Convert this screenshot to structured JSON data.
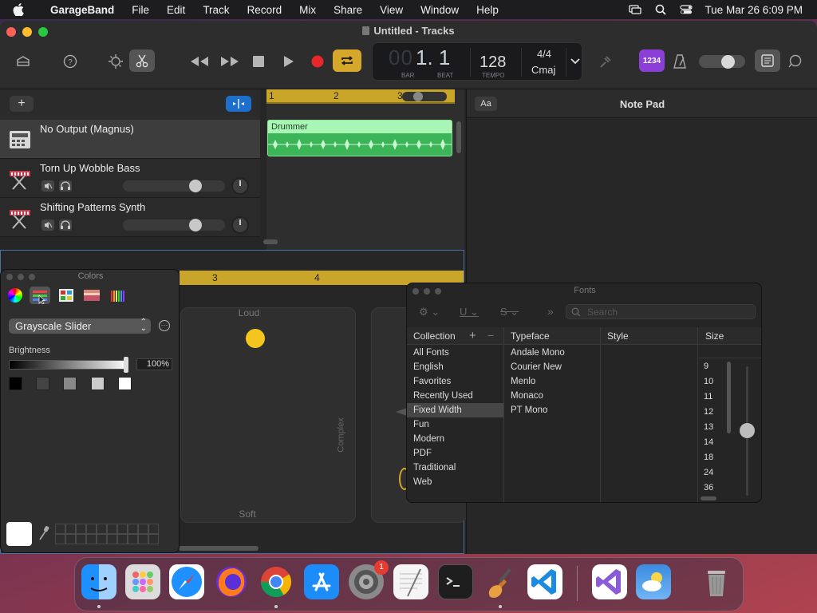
{
  "menubar": {
    "app_name": "GarageBand",
    "menus": [
      "File",
      "Edit",
      "Track",
      "Record",
      "Mix",
      "Share",
      "View",
      "Window",
      "Help"
    ],
    "clock": "Tue Mar 26  6:09 PM"
  },
  "window": {
    "title": "Untitled - Tracks"
  },
  "lcd": {
    "bar": "00",
    "beat": "1. 1",
    "bar_label": "BAR",
    "beat_label": "BEAT",
    "tempo": "128",
    "tempo_label": "TEMPO",
    "time_signature": "4/4",
    "key": "Cmaj"
  },
  "count_in_label": "1234",
  "tracks": [
    {
      "name": "No Output (Magnus)",
      "selected": true
    },
    {
      "name": "Torn Up Wobble Bass",
      "selected": false
    },
    {
      "name": "Shifting Patterns Synth",
      "selected": false
    }
  ],
  "timeline": {
    "ruler_marks": [
      "1",
      "2",
      "3"
    ],
    "region_label": "Drummer"
  },
  "smart_controls": {
    "ruler_marks": [
      "3",
      "4"
    ],
    "xy_top_label": "Loud",
    "xy_bottom_label": "Soft",
    "xy_side_label": "Complex"
  },
  "notepad": {
    "font_button": "Aa",
    "title": "Note Pad"
  },
  "colors_panel": {
    "title": "Colors",
    "mode": "Grayscale Slider",
    "brightness_label": "Brightness",
    "brightness_value": "100%",
    "brightness": 1.0,
    "swatches": [
      "#000000",
      "#444444",
      "#888888",
      "#cccccc",
      "#ffffff"
    ]
  },
  "fonts_panel": {
    "title": "Fonts",
    "search_placeholder": "Search",
    "headers": {
      "collection": "Collection",
      "typeface": "Typeface",
      "style": "Style",
      "size": "Size"
    },
    "collections": [
      "All Fonts",
      "English",
      "Favorites",
      "Recently Used",
      "Fixed Width",
      "Fun",
      "Modern",
      "PDF",
      "Traditional",
      "Web"
    ],
    "selected_collection": "Fixed Width",
    "typefaces": [
      "Andale Mono",
      "Courier New",
      "Menlo",
      "Monaco",
      "PT Mono"
    ],
    "sizes": [
      "9",
      "10",
      "11",
      "12",
      "13",
      "14",
      "18",
      "24",
      "36"
    ]
  },
  "dock": {
    "notification_badge": "1"
  }
}
